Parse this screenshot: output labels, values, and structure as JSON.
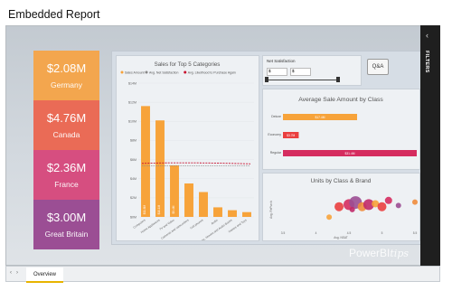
{
  "header": {
    "title": "Embedded Report"
  },
  "cards": [
    {
      "value": "$2.08M",
      "label": "Germany",
      "color": "#f3a64e"
    },
    {
      "value": "$4.76M",
      "label": "Canada",
      "color": "#ea6b56"
    },
    {
      "value": "$2.36M",
      "label": "France",
      "color": "#d64e80"
    },
    {
      "value": "$3.00M",
      "label": "Great Britain",
      "color": "#9b4e94"
    }
  ],
  "filters_label": "FILTERS",
  "qa_label": "Q&A",
  "slicer": {
    "title": "Net Satisfaction",
    "min_label": "$",
    "max_label": "$"
  },
  "tabs": {
    "active": "Overview"
  },
  "watermark": {
    "brand": "PowerBI",
    "suffix": "tips"
  },
  "chart_data": [
    {
      "type": "bar",
      "title": "Sales for Top 5 Categories",
      "legend": [
        "Sales Amount",
        "Avg. Net Satisfaction",
        "Avg. Likelihood to Purchase Again"
      ],
      "ylabels": [
        "$0M",
        "$2M",
        "$4M",
        "$6M",
        "$8M",
        "$10M",
        "$12M",
        "$14M"
      ],
      "ylim": [
        0,
        14
      ],
      "categories": [
        "Computers",
        "Home Appliances",
        "TV and Video",
        "Cameras and camcorders",
        "Cell phones",
        "Audio",
        "Music, Movies and Audio Books",
        "Games and Toys"
      ],
      "values": [
        11.6,
        10.1,
        5.4,
        3.5,
        2.6,
        1.0,
        0.7,
        0.5
      ],
      "bar_labels": [
        "$11.6M",
        "$10.1M",
        "$5.4M"
      ],
      "color": "#f7a33a",
      "line_color": "#c8102e"
    },
    {
      "type": "bar",
      "title": "Average Sale Amount by Class",
      "categories": [
        "Deluxe",
        "Economy",
        "Regular"
      ],
      "values": [
        17.4,
        3.7,
        31.4
      ],
      "value_labels": [
        "$17.4M",
        "$3.7M",
        "$31.4M"
      ],
      "colors": [
        "#f7a33a",
        "#ea3f3f",
        "#d52c5f"
      ]
    },
    {
      "type": "scatter",
      "title": "Units by Class & Brand",
      "xlabel": "Avg. NSAT",
      "ylabel": "Avg. RePurch",
      "xticks": [
        "3.5",
        "4",
        "4.5",
        "5",
        "5.5"
      ],
      "points": [
        [
          4.2,
          0.3,
          3
        ],
        [
          4.35,
          0.55,
          5
        ],
        [
          4.5,
          0.6,
          6
        ],
        [
          4.6,
          0.65,
          7
        ],
        [
          4.7,
          0.55,
          5
        ],
        [
          4.8,
          0.6,
          6
        ],
        [
          4.9,
          0.62,
          4
        ],
        [
          5.0,
          0.55,
          5
        ],
        [
          5.1,
          0.7,
          4
        ],
        [
          5.25,
          0.58,
          3
        ],
        [
          5.5,
          0.66,
          3
        ],
        [
          4.55,
          0.48,
          3
        ]
      ]
    }
  ]
}
